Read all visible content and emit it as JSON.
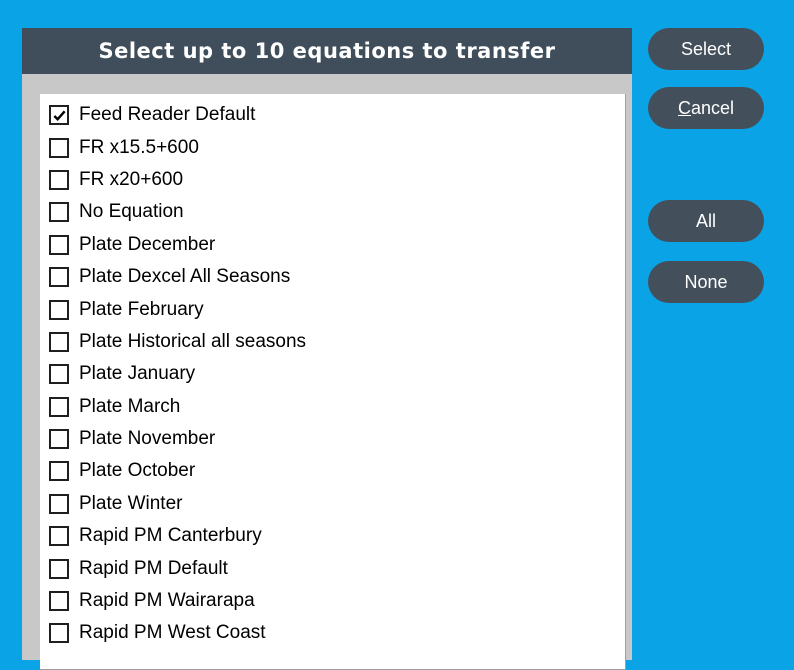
{
  "dialog": {
    "title": "Select up to 10 equations to transfer"
  },
  "buttons": {
    "select_label": "Select",
    "cancel_first": "C",
    "cancel_rest": "ancel",
    "all_label": "All",
    "none_label": "None"
  },
  "equations": [
    {
      "label": "Feed Reader Default",
      "checked": true
    },
    {
      "label": "FR x15.5+600",
      "checked": false
    },
    {
      "label": "FR x20+600",
      "checked": false
    },
    {
      "label": "No Equation",
      "checked": false
    },
    {
      "label": "Plate December",
      "checked": false
    },
    {
      "label": "Plate Dexcel All Seasons",
      "checked": false
    },
    {
      "label": "Plate February",
      "checked": false
    },
    {
      "label": "Plate Historical all seasons",
      "checked": false
    },
    {
      "label": "Plate January",
      "checked": false
    },
    {
      "label": "Plate March",
      "checked": false
    },
    {
      "label": "Plate November",
      "checked": false
    },
    {
      "label": "Plate October",
      "checked": false
    },
    {
      "label": "Plate Winter",
      "checked": false
    },
    {
      "label": "Rapid PM Canterbury",
      "checked": false
    },
    {
      "label": "Rapid PM Default",
      "checked": false
    },
    {
      "label": "Rapid PM Wairarapa",
      "checked": false
    },
    {
      "label": "Rapid PM West Coast",
      "checked": false
    }
  ],
  "colors": {
    "background": "#0aa3e6",
    "header": "#3f4e5a",
    "button": "#43505c",
    "panel": "#c8c8c8"
  }
}
